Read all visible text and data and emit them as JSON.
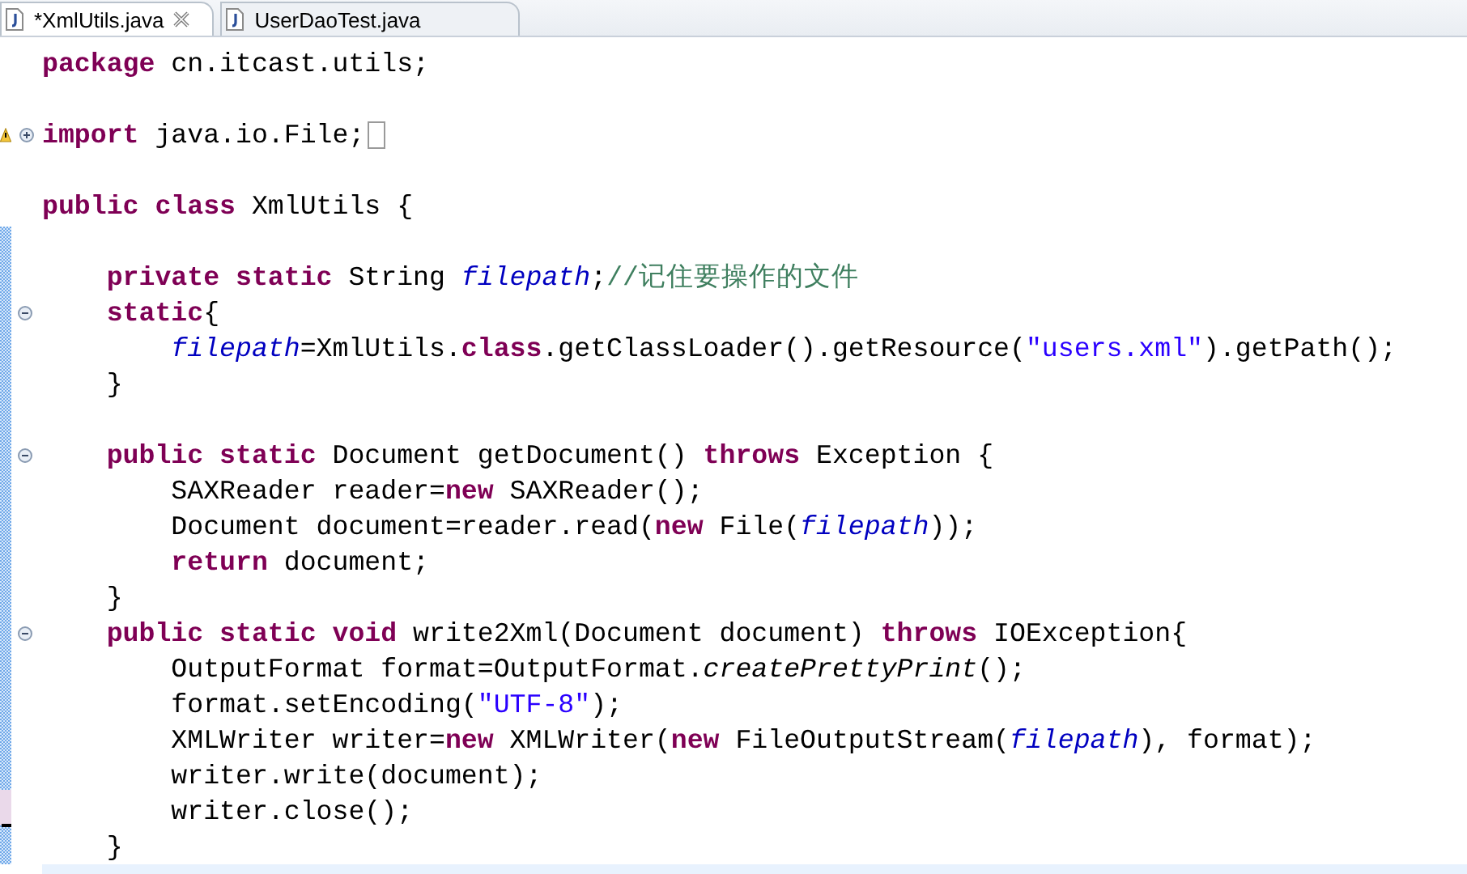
{
  "tabs": [
    {
      "label": "*XmlUtils.java",
      "selected": true,
      "closable": true
    },
    {
      "label": "UserDaoTest.java",
      "selected": false,
      "closable": false
    }
  ],
  "lines": [
    {
      "current": false,
      "tokens": [
        {
          "kind": "keyword",
          "text": "package"
        },
        {
          "kind": "plain",
          "text": " cn.itcast.utils;"
        }
      ]
    },
    {
      "current": false
    },
    {
      "current": false,
      "warning": true,
      "folded": true,
      "tokens": [
        {
          "kind": "keyword",
          "text": "import"
        },
        {
          "kind": "plain",
          "text": " java.io.File;"
        }
      ]
    },
    {
      "current": false
    },
    {
      "current": false,
      "tokens": [
        {
          "kind": "keyword",
          "text": "public class"
        },
        {
          "kind": "plain",
          "text": " XmlUtils {"
        }
      ]
    },
    {
      "current": false
    },
    {
      "current": false,
      "tokens": [
        {
          "kind": "keyword",
          "text": "    private static"
        },
        {
          "kind": "plain",
          "text": " String "
        },
        {
          "kind": "field",
          "text": "filepath"
        },
        {
          "kind": "plain",
          "text": ";"
        },
        {
          "kind": "comment",
          "text": "//记住要操作的文件"
        }
      ]
    },
    {
      "current": false,
      "folded": false,
      "tokens": [
        {
          "kind": "keyword",
          "text": "    static"
        },
        {
          "kind": "plain",
          "text": "{"
        }
      ]
    },
    {
      "current": false,
      "tokens": [
        {
          "kind": "field",
          "text": "        filepath"
        },
        {
          "kind": "plain",
          "text": "=XmlUtils."
        },
        {
          "kind": "keyword",
          "text": "class"
        },
        {
          "kind": "plain",
          "text": ".getClassLoader().getResource("
        },
        {
          "kind": "string",
          "text": "\"users.xml\""
        },
        {
          "kind": "plain",
          "text": ").getPath();"
        }
      ]
    },
    {
      "current": false,
      "tokens": [
        {
          "kind": "plain",
          "text": "    }"
        }
      ]
    },
    {
      "current": false
    },
    {
      "current": false,
      "folded": false,
      "tokens": [
        {
          "kind": "keyword",
          "text": "    public static"
        },
        {
          "kind": "plain",
          "text": " Document getDocument() "
        },
        {
          "kind": "keyword",
          "text": "throws"
        },
        {
          "kind": "plain",
          "text": " Exception {"
        }
      ]
    },
    {
      "current": false,
      "tokens": [
        {
          "kind": "plain",
          "text": "        SAXReader reader="
        },
        {
          "kind": "keyword",
          "text": "new"
        },
        {
          "kind": "plain",
          "text": " SAXReader();"
        }
      ]
    },
    {
      "current": false,
      "tokens": [
        {
          "kind": "plain",
          "text": "        Document document=reader.read("
        },
        {
          "kind": "keyword",
          "text": "new"
        },
        {
          "kind": "plain",
          "text": " File("
        },
        {
          "kind": "field",
          "text": "filepath"
        },
        {
          "kind": "plain",
          "text": "));"
        }
      ]
    },
    {
      "current": false,
      "tokens": [
        {
          "kind": "keyword",
          "text": "        return"
        },
        {
          "kind": "plain",
          "text": " document;"
        }
      ]
    },
    {
      "current": false,
      "tokens": [
        {
          "kind": "plain",
          "text": "    }"
        }
      ]
    },
    {
      "current": false,
      "folded": false,
      "tokens": [
        {
          "kind": "keyword",
          "text": "    public static void"
        },
        {
          "kind": "plain",
          "text": " write2Xml(Document document) "
        },
        {
          "kind": "keyword",
          "text": "throws"
        },
        {
          "kind": "plain",
          "text": " IOException{"
        }
      ]
    },
    {
      "current": false,
      "tokens": [
        {
          "kind": "plain",
          "text": "        OutputFormat format=OutputFormat."
        },
        {
          "kind": "static",
          "text": "createPrettyPrint"
        },
        {
          "kind": "plain",
          "text": "();"
        }
      ]
    },
    {
      "current": false,
      "tokens": [
        {
          "kind": "plain",
          "text": "        format.setEncoding("
        },
        {
          "kind": "string",
          "text": "\"UTF-8\""
        },
        {
          "kind": "plain",
          "text": ");"
        }
      ]
    },
    {
      "current": false,
      "tokens": [
        {
          "kind": "plain",
          "text": "        XMLWriter writer="
        },
        {
          "kind": "keyword",
          "text": "new"
        },
        {
          "kind": "plain",
          "text": " XMLWriter("
        },
        {
          "kind": "keyword",
          "text": "new"
        },
        {
          "kind": "plain",
          "text": " FileOutputStream("
        },
        {
          "kind": "field",
          "text": "filepath"
        },
        {
          "kind": "plain",
          "text": "), format);"
        }
      ]
    },
    {
      "current": false,
      "tokens": [
        {
          "kind": "plain",
          "text": "        writer.write(document);"
        }
      ]
    },
    {
      "current": false,
      "tokens": [
        {
          "kind": "plain",
          "text": "        writer.close();"
        }
      ]
    },
    {
      "current": false,
      "tokens": [
        {
          "kind": "plain",
          "text": "    }"
        }
      ]
    },
    {
      "current": true
    }
  ]
}
